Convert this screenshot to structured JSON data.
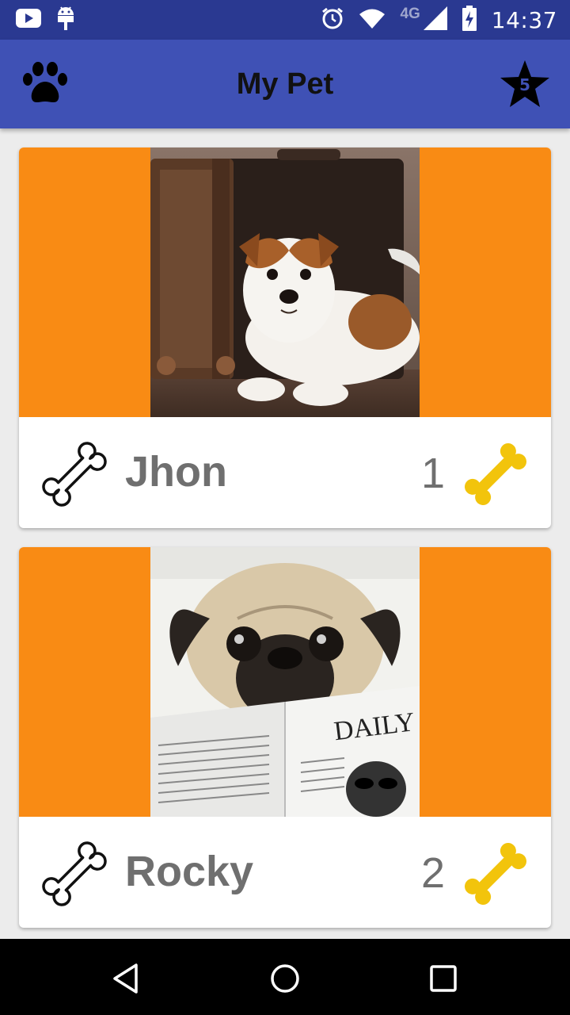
{
  "status_bar": {
    "time": "14:37",
    "network": "4G",
    "icons": [
      "youtube-icon",
      "android-debug-icon",
      "alarm-icon",
      "wifi-icon",
      "cell-signal-icon",
      "battery-charging-icon"
    ]
  },
  "app_bar": {
    "title": "My Pet",
    "left_icon": "paw-icon",
    "right_icon": "star-icon",
    "star_count": "5",
    "color": "#3f51b5"
  },
  "pets": [
    {
      "name": "Jhon",
      "bones": "1",
      "photo": "jack-russell-terrier-with-suitcase"
    },
    {
      "name": "Rocky",
      "bones": "2",
      "photo": "pug-reading-daily-newspaper"
    }
  ],
  "colors": {
    "card_media_bg": "#f98b14",
    "bone_gold": "#f2c40c",
    "name_text": "#6f6f6f",
    "status_bar": "#2a3991"
  },
  "nav_bar": {
    "buttons": [
      "back-icon",
      "home-icon",
      "recent-apps-icon"
    ]
  }
}
